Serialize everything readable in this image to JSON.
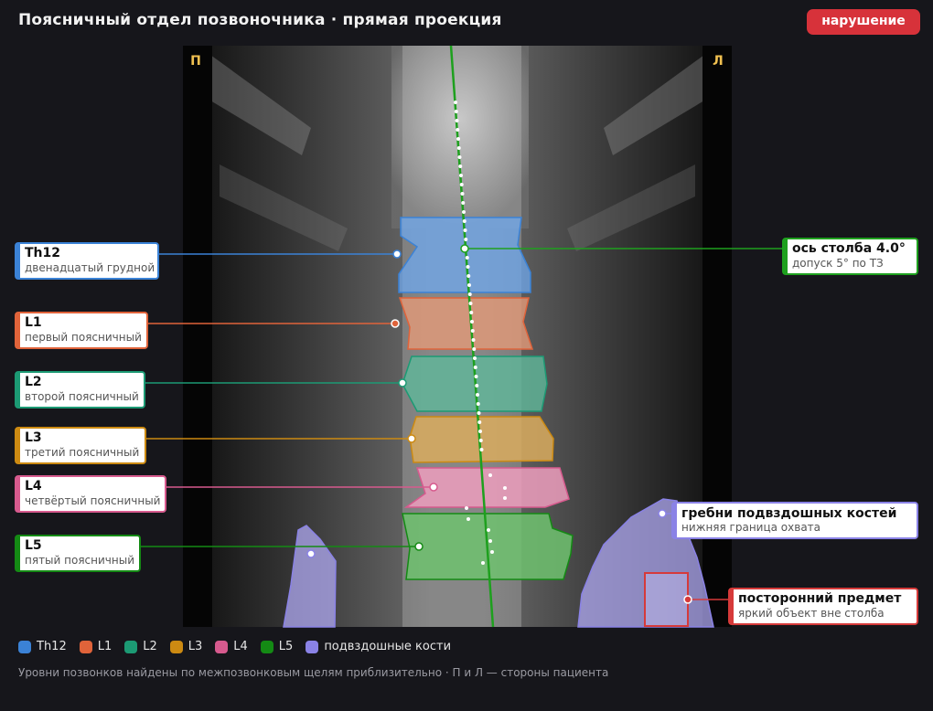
{
  "header": {
    "title": "Поясничный отдел позвоночника · прямая проекция",
    "status_badge": "нарушение"
  },
  "image": {
    "side_left": "П",
    "side_right": "Л"
  },
  "labels": [
    {
      "id": "th12",
      "title": "Th12",
      "sub": "двенадцатый грудной",
      "color": "#3b82d6"
    },
    {
      "id": "l1",
      "title": "L1",
      "sub": "первый поясничный",
      "color": "#e0633a"
    },
    {
      "id": "l2",
      "title": "L2",
      "sub": "второй поясничный",
      "color": "#1c9a74"
    },
    {
      "id": "l3",
      "title": "L3",
      "sub": "третий поясничный",
      "color": "#cc8a12"
    },
    {
      "id": "l4",
      "title": "L4",
      "sub": "четвёртый поясничный",
      "color": "#d75a8e"
    },
    {
      "id": "l5",
      "title": "L5",
      "sub": "пятый поясничный",
      "color": "#148a14"
    }
  ],
  "axis": {
    "title": "ось столба 4.0°",
    "sub": "допуск 5° по ТЗ",
    "color": "#1ea01e"
  },
  "iliac": {
    "title": "гребни подвздошных костей",
    "sub": "нижняя граница охвата",
    "color": "#8a82e6"
  },
  "foreign": {
    "title": "посторонний предмет",
    "sub": "яркий объект вне столба",
    "color": "#d63a3a"
  },
  "legend": [
    {
      "label": "Th12",
      "color": "#3b82d6"
    },
    {
      "label": "L1",
      "color": "#e0633a"
    },
    {
      "label": "L2",
      "color": "#1c9a74"
    },
    {
      "label": "L3",
      "color": "#cc8a12"
    },
    {
      "label": "L4",
      "color": "#d75a8e"
    },
    {
      "label": "L5",
      "color": "#148a14"
    },
    {
      "label": "подвздошные кости",
      "color": "#8a82e6"
    }
  ],
  "footnote": "Уровни позвонков найдены по межпозвонковым щелям приблизительно · П и Л — стороны пациента"
}
